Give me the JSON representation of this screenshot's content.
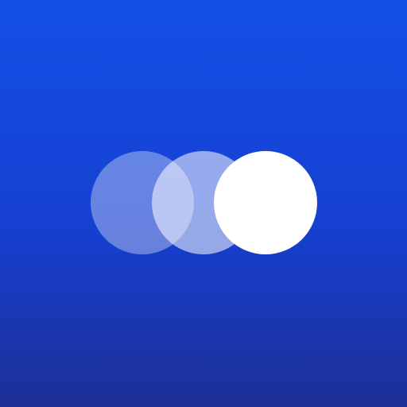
{
  "app_icon": {
    "name": "overlapping-circles-logo",
    "colors": {
      "background_top": "#1450e6",
      "background_bottom": "#1d2f96",
      "circle_fill": "#ffffff"
    },
    "circles": [
      {
        "icon": "circle-faint",
        "opacity": 0.35
      },
      {
        "icon": "circle-medium",
        "opacity": 0.55
      },
      {
        "icon": "circle-solid",
        "opacity": 1.0
      }
    ]
  }
}
